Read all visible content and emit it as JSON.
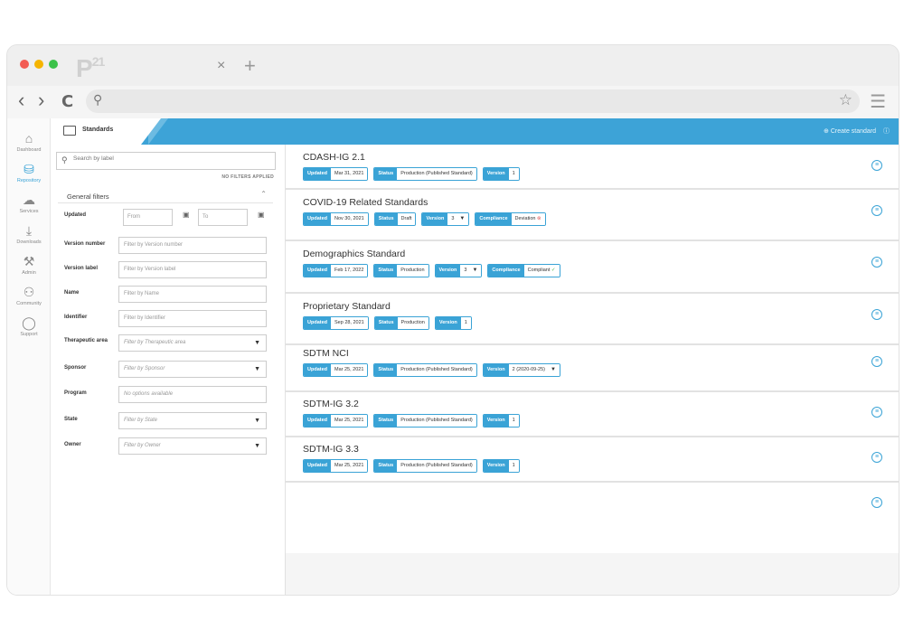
{
  "browser": {
    "logo": "P",
    "logo_sup": "21",
    "tab_close": "×",
    "tab_new": "+",
    "back": "‹",
    "forward": "›",
    "reload": "C",
    "menu": "☰"
  },
  "sidebar": {
    "items": [
      {
        "label": "Dashboard",
        "icon": "home-icon"
      },
      {
        "label": "Repository",
        "icon": "database-icon"
      },
      {
        "label": "Services",
        "icon": "cloud-icon"
      },
      {
        "label": "Downloads",
        "icon": "download-icon"
      },
      {
        "label": "Admin",
        "icon": "wrench-icon"
      },
      {
        "label": "Community",
        "icon": "community-icon"
      },
      {
        "label": "Support",
        "icon": "chat-icon"
      }
    ]
  },
  "header": {
    "breadcrumb": "Standards",
    "create_label": "Create standard"
  },
  "filters": {
    "search_placeholder": "Search by label",
    "status": "NO FILTERS APPLIED",
    "group_title": "General filters",
    "updated": {
      "label": "Updated",
      "from": "From",
      "to": "To"
    },
    "fields": [
      {
        "label": "Version number",
        "placeholder": "Filter by Version number"
      },
      {
        "label": "Version label",
        "placeholder": "Filter by Version label"
      },
      {
        "label": "Name",
        "placeholder": "Filter by Name"
      },
      {
        "label": "Identifier",
        "placeholder": "Filter by Identifier"
      },
      {
        "label": "Therapeutic area",
        "placeholder": "Filter by Therapeutic area"
      },
      {
        "label": "Sponsor",
        "placeholder": "Filter by Sponsor"
      },
      {
        "label": "Program",
        "placeholder": "No options available"
      },
      {
        "label": "State",
        "placeholder": "Filter by State"
      },
      {
        "label": "Owner",
        "placeholder": "Filter by Owner"
      }
    ]
  },
  "labels": {
    "updated": "Updated",
    "status": "Status",
    "version": "Version",
    "compliance": "Compliance"
  },
  "standards": [
    {
      "title": "CDASH-IG 2.1",
      "updated": "Mar 31, 2021",
      "status": "Production (Published Standard)",
      "version": "1"
    },
    {
      "title": "COVID-19 Related Standards",
      "updated": "Nov 30, 2021",
      "status": "Draft",
      "version": "3",
      "compliance": "Deviation"
    },
    {
      "title": "Demographics Standard",
      "updated": "Feb 17, 2022",
      "status": "Production",
      "version": "3",
      "compliance": "Compliant"
    },
    {
      "title": "Proprietary Standard",
      "updated": "Sep 28, 2021",
      "status": "Production",
      "version": "1"
    },
    {
      "title": "SDTM NCI",
      "updated": "Mar 25, 2021",
      "status": "Production (Published Standard)",
      "version": "2 (2020-09-25)"
    },
    {
      "title": "SDTM-IG 3.2",
      "updated": "Mar 25, 2021",
      "status": "Production (Published Standard)",
      "version": "1"
    },
    {
      "title": "SDTM-IG 3.3",
      "updated": "Mar 25, 2021",
      "status": "Production (Published Standard)",
      "version": "1"
    }
  ],
  "colors": {
    "accent": "#3da3d7",
    "compliant": "#4bb34b",
    "deviation": "#e05a5a"
  }
}
